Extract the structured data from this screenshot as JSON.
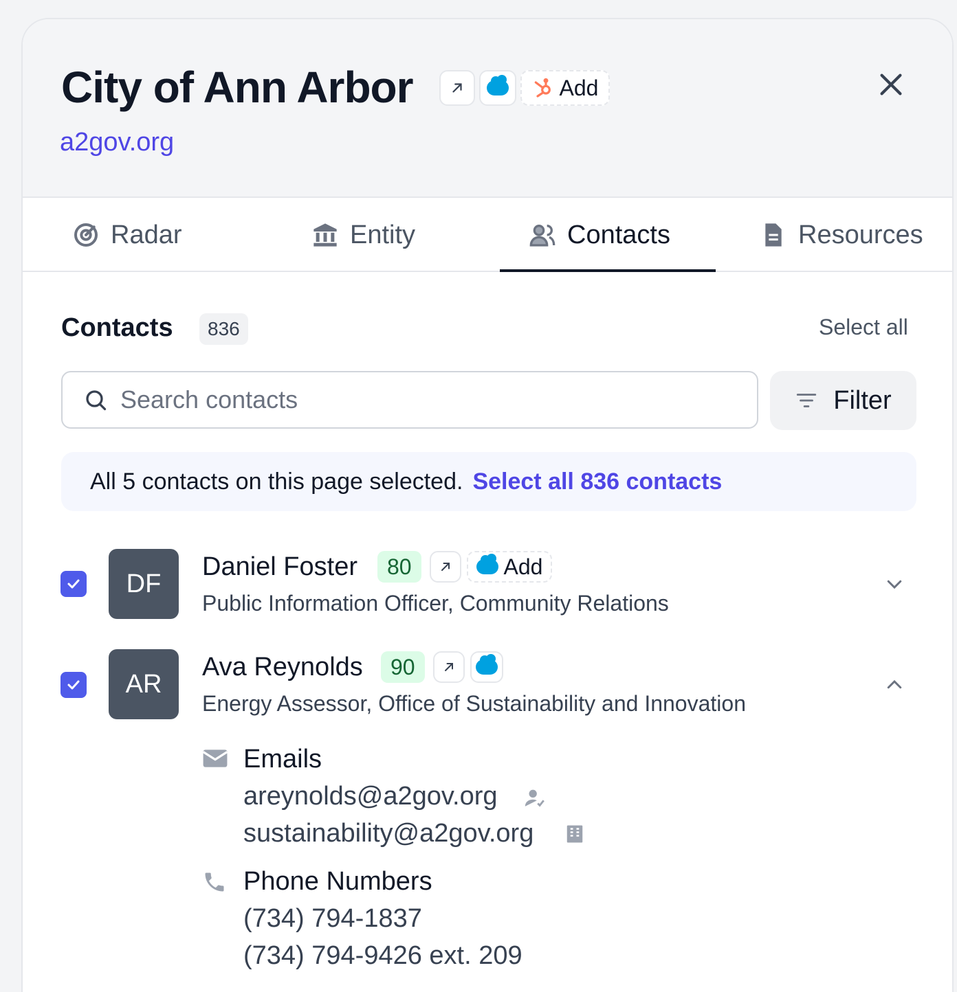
{
  "entity": {
    "name": "City of Ann Arbor",
    "domain": "a2gov.org",
    "add_label": "Add"
  },
  "tabs": [
    {
      "label": "Radar",
      "icon": "radar-icon"
    },
    {
      "label": "Entity",
      "icon": "bank-icon"
    },
    {
      "label": "Contacts",
      "icon": "users-icon",
      "active": true
    },
    {
      "label": "Resources",
      "icon": "document-icon"
    }
  ],
  "contacts_section": {
    "title": "Contacts",
    "count": "836",
    "select_all": "Select all",
    "search_placeholder": "Search contacts",
    "filter_label": "Filter",
    "banner_text": "All 5 contacts on this page selected.",
    "banner_link": "Select all 836 contacts"
  },
  "contacts": [
    {
      "initials": "DF",
      "name": "Daniel Foster",
      "score": "80",
      "title": "Public Information Officer, Community Relations",
      "add_label": "Add",
      "selected": true,
      "expanded": false
    },
    {
      "initials": "AR",
      "name": "Ava Reynolds",
      "score": "90",
      "title": "Energy Assessor, Office of Sustainability and Innovation",
      "selected": true,
      "expanded": true,
      "emails_label": "Emails",
      "emails": [
        "areynolds@a2gov.org",
        "sustainability@a2gov.org"
      ],
      "phones_label": "Phone Numbers",
      "phones": [
        "(734) 794-1837",
        "(734) 794-9426 ext. 209"
      ]
    }
  ],
  "colors": {
    "accent": "#4f46e5",
    "checkbox": "#4f5bea",
    "salesforce": "#00a1e0",
    "hubspot": "#ff7a59",
    "score_bg": "#dcfce7"
  }
}
